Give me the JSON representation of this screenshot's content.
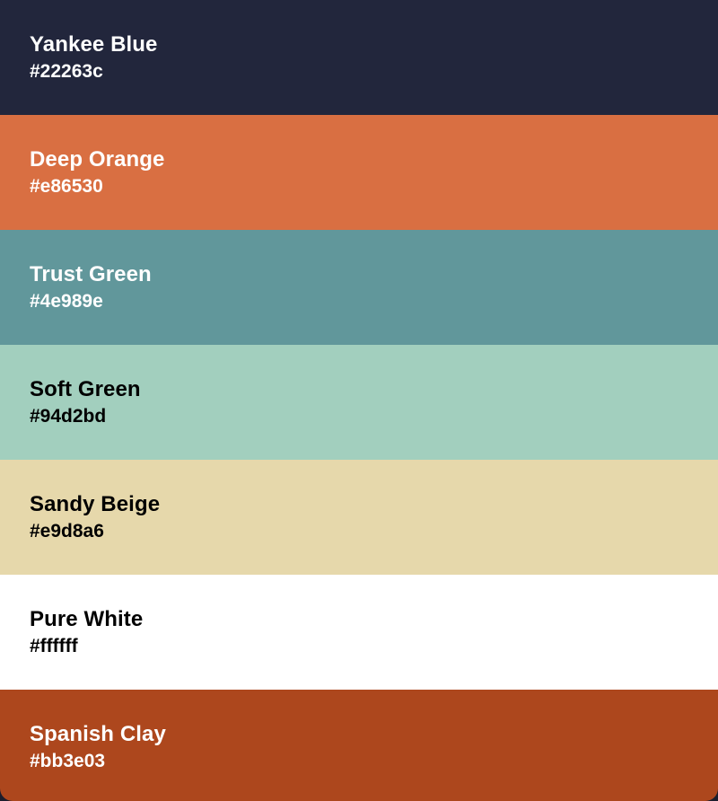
{
  "palette": {
    "swatches": [
      {
        "name": "Yankee Blue",
        "hex": "#22263c",
        "background": "#22263c",
        "text_color": "#ffffff"
      },
      {
        "name": "Deep Orange",
        "hex": "#e86530",
        "background": "#d96f42",
        "text_color": "#ffffff"
      },
      {
        "name": "Trust Green",
        "hex": "#4e989e",
        "background": "#61979b",
        "text_color": "#ffffff"
      },
      {
        "name": "Soft Green",
        "hex": "#94d2bd",
        "background": "#a2cfbe",
        "text_color": "#000000"
      },
      {
        "name": "Sandy Beige",
        "hex": "#e9d8a6",
        "background": "#e6d8ab",
        "text_color": "#000000"
      },
      {
        "name": "Pure White",
        "hex": "#ffffff",
        "background": "#ffffff",
        "text_color": "#000000"
      },
      {
        "name": "Spanish Clay",
        "hex": "#bb3e03",
        "background": "#ad471d",
        "text_color": "#ffffff"
      }
    ]
  }
}
